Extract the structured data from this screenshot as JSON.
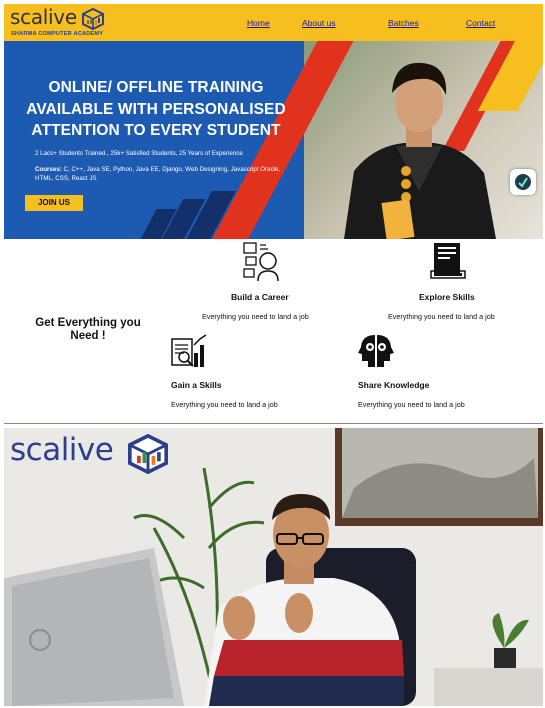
{
  "header": {
    "logo_word": "scalive",
    "logo_subtitle": "SHARMA COMPUTER ACADEMY",
    "nav": [
      {
        "label": "Home"
      },
      {
        "label": "About us"
      },
      {
        "label": "Batches"
      },
      {
        "label": "Contact"
      }
    ]
  },
  "hero": {
    "title": "ONLINE/ OFFLINE TRAINING AVAILABLE WITH PERSONALISED ATTENTION TO EVERY STUDENT",
    "stats": "2 Lacs+ Students Trained., 25k+ Satisfied Students, 25 Years of Experience",
    "courses_label": "Courses:",
    "courses": " C, C++, Java SE, Python, Java EE, Django, Web Designing, Javascript Oracle, HTML, CSS, React JS",
    "cta": "JOIN US"
  },
  "features": {
    "tagline": "Get Everything you Need !",
    "items": [
      {
        "title": "Build a Career",
        "desc": "Everything you need to land a job",
        "icon": "career-icon"
      },
      {
        "title": "Explore Skills",
        "desc": "Everything you need to land a job",
        "icon": "programming-book-icon"
      },
      {
        "title": "Gain a Skills",
        "desc": "Everything you need to land a job",
        "icon": "analytics-icon"
      },
      {
        "title": "Share Knowledge",
        "desc": "Everything you need to land a job",
        "icon": "brain-heads-icon"
      }
    ]
  },
  "video": {
    "logo_word": "scalive"
  },
  "colors": {
    "brand_yellow": "#f6be1f",
    "brand_blue": "#1d5bb3",
    "brand_red": "#e0321c",
    "link": "#1a1aa6"
  }
}
